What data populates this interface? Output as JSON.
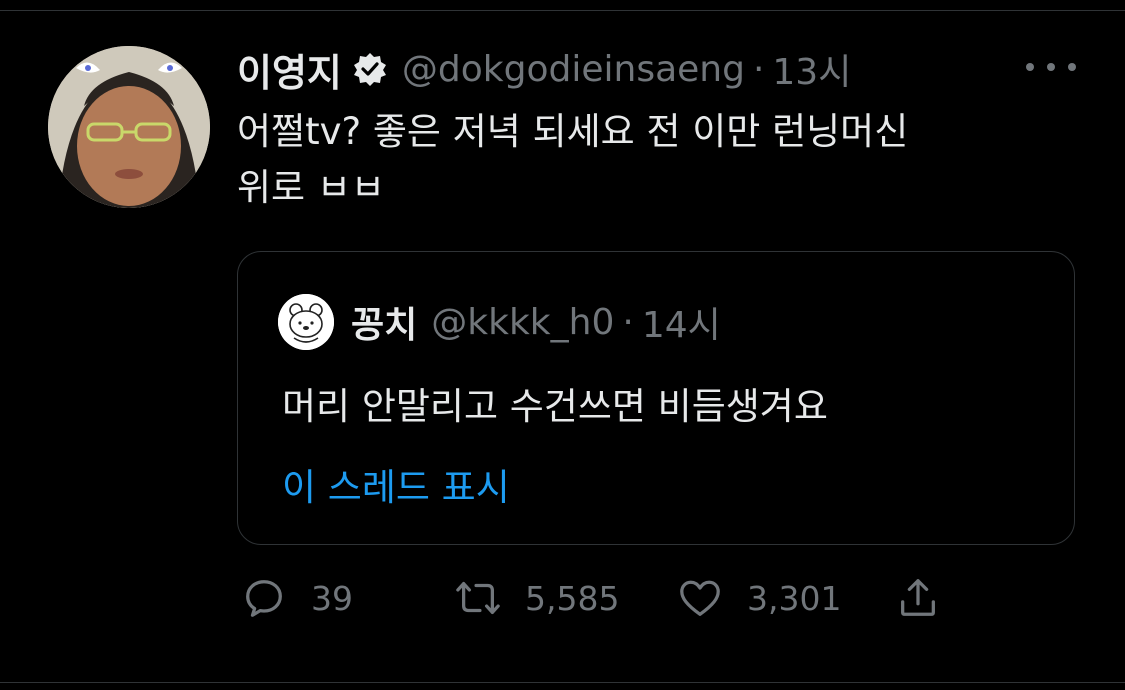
{
  "tweet": {
    "display_name": "이영지",
    "handle": "@dokgodieinsaeng",
    "separator": "·",
    "time": "13시",
    "text_line1": "어쩔tv? 좋은 저녁 되세요 전 이만 런닝머신",
    "text_line2": "위로 ㅂㅂ",
    "icons": {
      "verified": "verified-badge-icon",
      "more": "more-options-icon"
    }
  },
  "quote": {
    "display_name": "꽁치",
    "handle": "@kkkk_h0",
    "separator": "·",
    "time": "14시",
    "text": "머리 안말리고 수건쓰면 비듬생겨요",
    "show_thread": "이 스레드 표시"
  },
  "actions": {
    "reply_count": "39",
    "retweet_count": "5,585",
    "like_count": "3,301",
    "icons": [
      "reply-icon",
      "retweet-icon",
      "like-icon",
      "share-icon"
    ]
  },
  "colors": {
    "background": "#000000",
    "text": "#e7e9ea",
    "secondary": "#71767b",
    "link": "#1d9bf0",
    "border": "#2f3336"
  }
}
